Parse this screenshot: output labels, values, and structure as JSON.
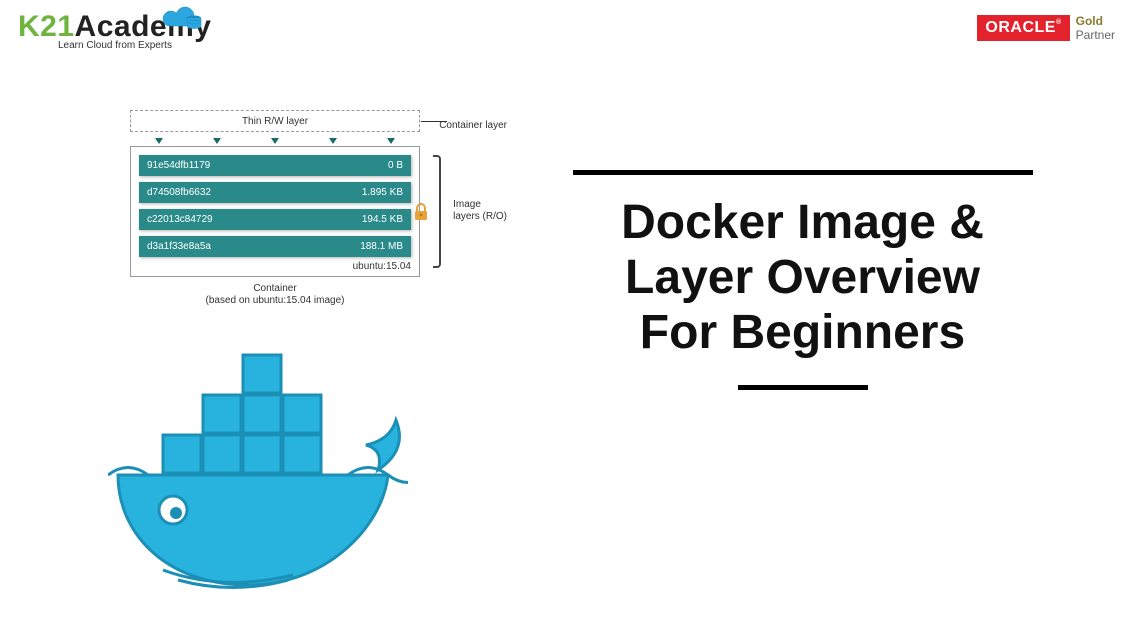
{
  "header": {
    "k21_brand_prefix": "K21",
    "k21_brand_suffix": "Academy",
    "k21_tagline": "Learn Cloud from Experts",
    "oracle_label": "ORACLE",
    "oracle_gold": "Gold",
    "oracle_partner": "Partner"
  },
  "title": {
    "line1": "Docker Image &",
    "line2": "Layer Overview",
    "line3": "For Beginners"
  },
  "diagram": {
    "rw_layer_label": "Thin R/W layer",
    "container_layer_label": "Container layer",
    "layers": [
      {
        "hash": "91e54dfb1179",
        "size": "0 B"
      },
      {
        "hash": "d74508fb6632",
        "size": "1.895 KB"
      },
      {
        "hash": "c22013c84729",
        "size": "194.5 KB"
      },
      {
        "hash": "d3a1f33e8a5a",
        "size": "188.1 MB"
      }
    ],
    "base_tag": "ubuntu:15.04",
    "image_layers_label_1": "Image",
    "image_layers_label_2": "layers (R/O)",
    "caption_line1": "Container",
    "caption_line2": "(based on ubuntu:15.04 image)"
  }
}
